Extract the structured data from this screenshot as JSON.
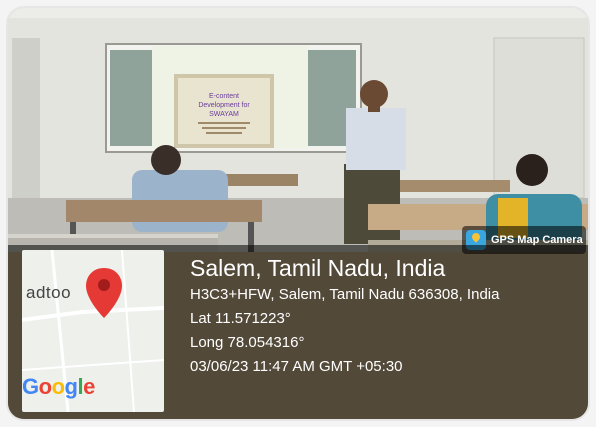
{
  "watermark": {
    "app_name": "GPS Map Camera",
    "icon": "gps-map-camera-app-icon",
    "accent_color": "#3aa6e0"
  },
  "slide": {
    "title_line1": "E-content",
    "title_line2": "Development for",
    "title_line3": "SWAYAM"
  },
  "map": {
    "street_fragment": "adtoo",
    "pin_icon": "location-pin-icon",
    "pin_color": "#e53935",
    "provider_letters": [
      "G",
      "o",
      "o",
      "g",
      "l",
      "e"
    ]
  },
  "location": {
    "city": "Salem, Tamil Nadu, India",
    "address": "H3C3+HFW, Salem, Tamil Nadu 636308, India",
    "latitude": "Lat 11.571223°",
    "longitude": "Long 78.054316°",
    "datetime": "03/06/23 11:47 AM GMT +05:30"
  }
}
